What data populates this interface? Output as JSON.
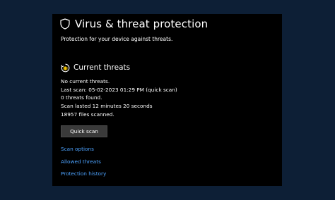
{
  "header": {
    "title": "Virus & threat protection",
    "subtitle": "Protection for your device against threats."
  },
  "current_threats": {
    "heading": "Current threats",
    "lines": [
      "No current threats.",
      "Last scan: 05-02-2023 01:29 PM (quick scan)",
      "0 threats found.",
      "Scan lasted 12 minutes 20 seconds",
      "18957 files scanned."
    ],
    "button_label": "Quick scan"
  },
  "links": {
    "scan_options": "Scan options",
    "allowed_threats": "Allowed threats",
    "protection_history": "Protection history"
  },
  "icons": {
    "header": "shield-icon",
    "section": "threat-scan-icon"
  },
  "colors": {
    "background": "#0d1f36",
    "panel": "#000000",
    "link": "#4da3ff",
    "button": "#3a3a3a",
    "text": "#ffffff"
  }
}
